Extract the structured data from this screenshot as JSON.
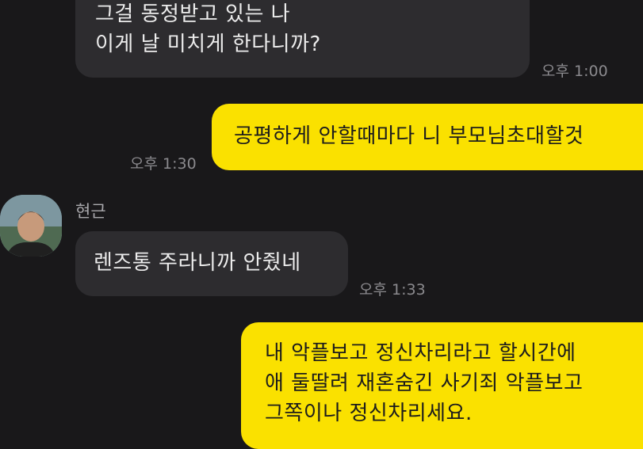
{
  "messages": [
    {
      "direction": "in",
      "lines": [
        "그걸 동정받고 있는 나",
        "이게 날 미치게 한다니까?"
      ],
      "time": "오후 1:00"
    },
    {
      "direction": "out",
      "lines": [
        "공평하게 안할때마다 니 부모님초대할것"
      ],
      "time": "오후 1:30"
    },
    {
      "direction": "in",
      "sender": "현근",
      "lines": [
        "렌즈통 주라니까 안줬네"
      ],
      "time": "오후 1:33"
    },
    {
      "direction": "out",
      "lines": [
        "내 악플보고 정신차리라고 할시간에",
        "애 둘딸려 재혼숨긴 사기죄 악플보고",
        "그쪽이나 정신차리세요."
      ],
      "time": ""
    }
  ],
  "colors": {
    "background": "#19181a",
    "incoming_bubble": "#2d2c2f",
    "outgoing_bubble": "#fae100",
    "timestamp": "#8b8a8e"
  },
  "icons": {
    "avatar": "profile-photo"
  }
}
